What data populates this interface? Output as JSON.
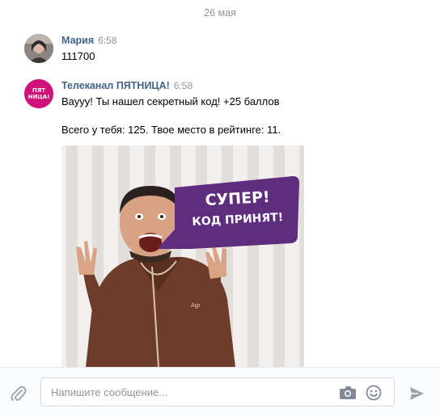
{
  "date_separator": "26 мая",
  "messages": [
    {
      "author": "Мария",
      "time": "6:58",
      "lines": [
        "111700"
      ]
    },
    {
      "author": "Телеканал ПЯТНИЦА!",
      "time": "6:58",
      "lines": [
        "Вауyy! Ты нашел секретный код! +25 баллов",
        "Всего у тебя: 125. Твое место в рейтинге: 11."
      ],
      "avatar_text": "ПЯТ НИЦА!",
      "attachment": {
        "bubble_line1": "СУПЕР!",
        "bubble_line2": "КОД ПРИНЯТ!",
        "apron_text": "Agramov"
      }
    }
  ],
  "composer": {
    "placeholder": "Напишите сообщение..."
  },
  "icons": {
    "attach": "paperclip-icon",
    "camera": "camera-icon",
    "emoji": "smile-icon",
    "send": "send-icon"
  },
  "colors": {
    "author_link": "#42648b",
    "muted": "#939393",
    "brand_pink": "#d0117a",
    "bubble_purple": "#5e2d7e"
  }
}
